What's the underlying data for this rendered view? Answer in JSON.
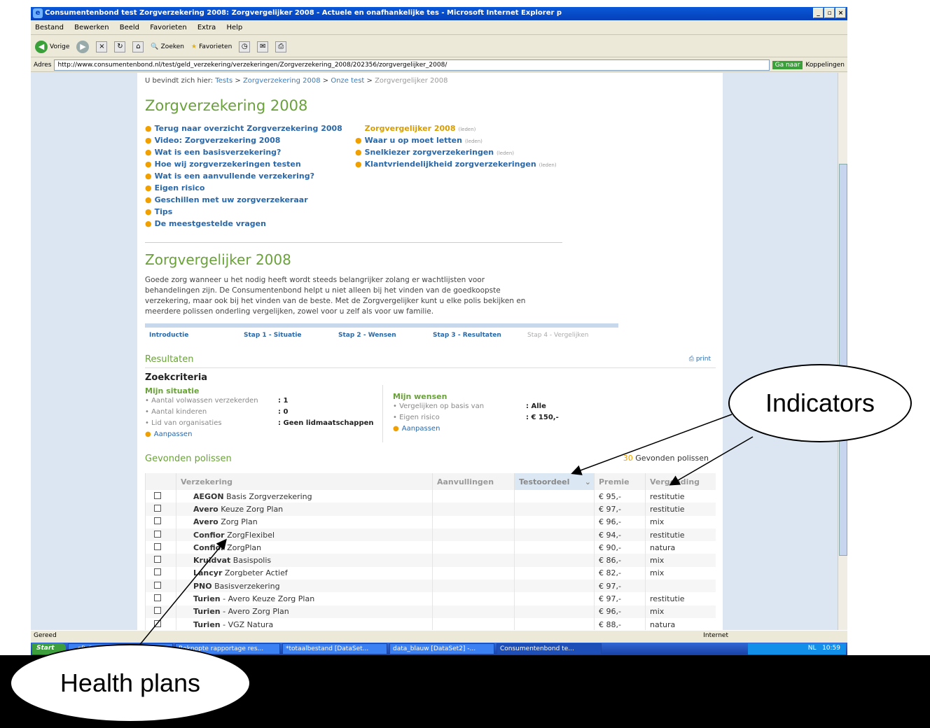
{
  "window": {
    "title": "Consumentenbond test Zorgverzekering 2008: Zorgvergelijker 2008 - Actuele en onafhankelijke tes - Microsoft Internet Explorer p"
  },
  "menu": [
    "Bestand",
    "Bewerken",
    "Beeld",
    "Favorieten",
    "Extra",
    "Help"
  ],
  "toolbar": {
    "back": "Vorige",
    "search": "Zoeken",
    "favorites": "Favorieten"
  },
  "address": {
    "label": "Adres",
    "url": "http://www.consumentenbond.nl/test/geld_verzekering/verzekeringen/Zorgverzekering_2008/202356/zorgvergelijker_2008/",
    "go": "Ga naar",
    "links": "Koppelingen"
  },
  "breadcrumb": {
    "prefix": "U bevindt zich hier:",
    "items": [
      "Tests",
      "Zorgverzekering 2008",
      "Onze test"
    ],
    "current": "Zorgvergelijker 2008"
  },
  "heading1": "Zorgverzekering 2008",
  "links_left": [
    "Terug naar overzicht Zorgverzekering 2008",
    "Video: Zorgverzekering 2008",
    "Wat is een basisverzekering?",
    "Hoe wij zorgverzekeringen testen",
    "Wat is een aanvullende verzekering?",
    "Eigen risico",
    "Geschillen met uw zorgverzekeraar",
    "Tips",
    "De meestgestelde vragen"
  ],
  "links_right": [
    {
      "label": "Zorgvergelijker 2008",
      "tag": "(leden)"
    },
    {
      "label": "Waar u op moet letten",
      "tag": "(leden)"
    },
    {
      "label": "Snelkiezer zorgverzekeringen",
      "tag": "(leden)"
    },
    {
      "label": "Klantvriendelijkheid zorgverzekeringen",
      "tag": "(leden)"
    }
  ],
  "heading2": "Zorgvergelijker 2008",
  "intro": "Goede zorg wanneer u het nodig heeft wordt steeds belangrijker zolang er wachtlijsten voor behandelingen zijn. De Consumentenbond helpt u niet alleen bij het vinden van de goedkoopste verzekering, maar ook bij het vinden van de beste. Met de Zorgvergelijker kunt u elke polis bekijken en meerdere polissen onderling vergelijken, zowel voor u zelf als voor uw familie.",
  "steps": [
    "Introductie",
    "Stap 1 - Situatie",
    "Stap 2 - Wensen",
    "Stap 3 - Resultaten",
    "Stap 4 - Vergelijken"
  ],
  "results": {
    "title": "Resultaten",
    "print": "print",
    "criteria": "Zoekcriteria",
    "situation": {
      "title": "Mijn situatie",
      "rows": [
        {
          "k": "Aantal volwassen verzekerden",
          "v": ": 1"
        },
        {
          "k": "Aantal kinderen",
          "v": ": 0"
        },
        {
          "k": "Lid van organisaties",
          "v": ": Geen lidmaatschappen"
        }
      ],
      "edit": "Aanpassen"
    },
    "wishes": {
      "title": "Mijn wensen",
      "rows": [
        {
          "k": "Vergelijken op basis van",
          "v": ": Alle"
        },
        {
          "k": "Eigen risico",
          "v": ": € 150,-"
        }
      ],
      "edit": "Aanpassen"
    },
    "found_title": "Gevonden polissen",
    "found_count": "30",
    "found_label": "Gevonden polissen"
  },
  "table": {
    "headers": [
      "Verzekering",
      "Aanvullingen",
      "Testoordeel",
      "Premie",
      "Vergoeding"
    ],
    "rows": [
      {
        "b": "AEGON",
        "n": "Basis Zorgverzekering",
        "p": "€ 95,-",
        "v": "restitutie"
      },
      {
        "b": "Avero",
        "n": "Keuze Zorg Plan",
        "p": "€ 97,-",
        "v": "restitutie"
      },
      {
        "b": "Avero",
        "n": "Zorg Plan",
        "p": "€ 96,-",
        "v": "mix"
      },
      {
        "b": "Confior",
        "n": "ZorgFlexibel",
        "p": "€ 94,-",
        "v": "restitutie"
      },
      {
        "b": "Confior",
        "n": "ZorgPlan",
        "p": "€ 90,-",
        "v": "natura"
      },
      {
        "b": "Kruidvat",
        "n": "Basispolis",
        "p": "€ 86,-",
        "v": "mix"
      },
      {
        "b": "Lancyr",
        "n": "Zorgbeter Actief",
        "p": "€ 82,-",
        "v": "mix"
      },
      {
        "b": "PNO",
        "n": "Basisverzekering",
        "p": "€ 97,-",
        "v": ""
      },
      {
        "b": "Turien",
        "n": "- Avero Keuze Zorg Plan",
        "p": "€ 97,-",
        "v": "restitutie"
      },
      {
        "b": "Turien",
        "n": "- Avero Zorg Plan",
        "p": "€ 96,-",
        "v": "mix"
      },
      {
        "b": "Turien",
        "n": "- VGZ Natura",
        "p": "€ 88,-",
        "v": "natura"
      }
    ]
  },
  "status": {
    "text": "Gereed",
    "zone": "Internet"
  },
  "taskbar": {
    "start": "Start",
    "items": [
      "...oft O...",
      "Beknopte rapportage res...",
      "*totaalbestand [DataSet...",
      "data_blauw [DataSet2] -...",
      "Consumentenbond te..."
    ],
    "lang": "NL",
    "clock": "10:59"
  },
  "callouts": {
    "indicators": "Indicators",
    "health": "Health plans"
  }
}
